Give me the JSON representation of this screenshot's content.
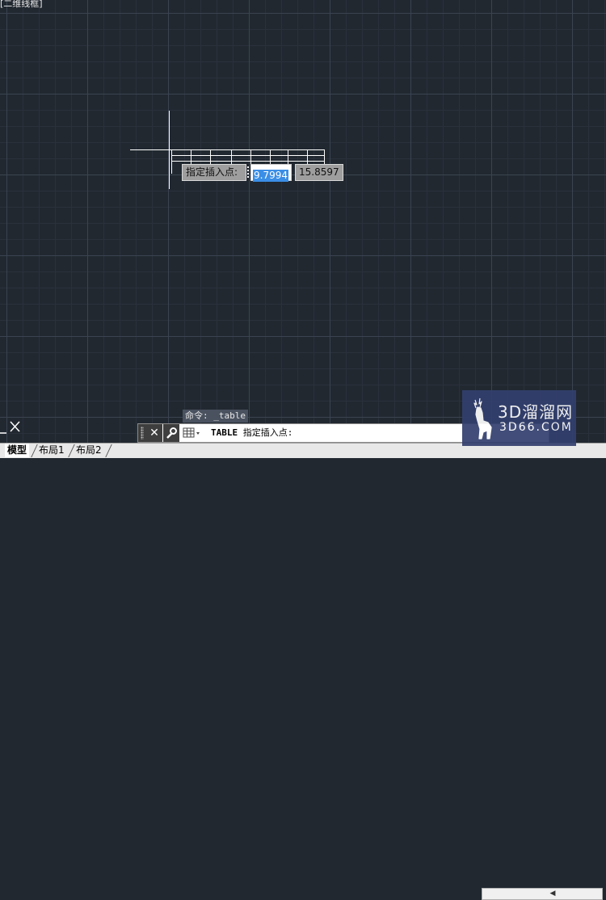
{
  "window": {
    "title_fragment": "[二维线框]"
  },
  "dynamic_input": {
    "prompt_label": "指定插入点:",
    "x_value": "9.7994",
    "y_value": "15.8597"
  },
  "command_line": {
    "history": "命令: _table",
    "close_icon": "close-icon",
    "customize_icon": "wrench-icon",
    "recent_icon": "table-icon",
    "current_command": "TABLE",
    "current_prompt": " 指定插入点:"
  },
  "layout_tabs": [
    {
      "label": "模型",
      "active": true
    },
    {
      "label": "布局1",
      "active": false
    },
    {
      "label": "布局2",
      "active": false
    }
  ],
  "watermark": {
    "brand": "3D溜溜网",
    "domain": "3D66.COM",
    "logo_icon": "deer-logo-icon"
  },
  "colors": {
    "canvas_bg": "#212830",
    "selection": "#3a8ee6",
    "watermark_bg": "#333f6e"
  }
}
